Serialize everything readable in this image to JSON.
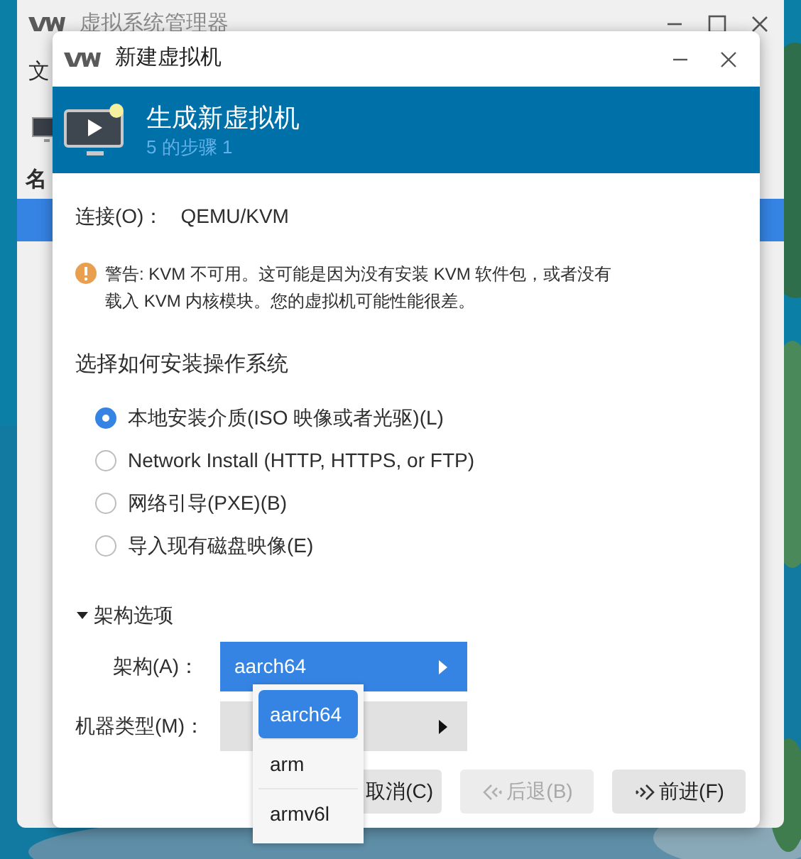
{
  "main_window": {
    "title": "虚拟系统管理器",
    "menu_fragment": "文",
    "column_header_fragment": "名"
  },
  "dialog": {
    "title": "新建虚拟机",
    "header": {
      "title": "生成新虚拟机",
      "subtitle": "5 的步骤 1"
    },
    "connection": {
      "label": "连接(O)：",
      "value": "QEMU/KVM"
    },
    "warning_lines": [
      "警告: KVM 不可用。这可能是因为没有安装 KVM 软件包，或者没有",
      "载入 KVM 内核模块。您的虚拟机可能性能很差。"
    ],
    "install_prompt": "选择如何安装操作系统",
    "install_options": [
      {
        "label": "本地安装介质(ISO 映像或者光驱)(L)",
        "selected": true
      },
      {
        "label": "Network Install (HTTP, HTTPS, or FTP)",
        "selected": false
      },
      {
        "label": "网络引导(PXE)(B)",
        "selected": false
      },
      {
        "label": "导入现有磁盘映像(E)",
        "selected": false
      }
    ],
    "arch_section": {
      "label": "架构选项",
      "expanded": true,
      "fields": [
        {
          "label": "架构(A)：",
          "value": "aarch64",
          "open": true
        },
        {
          "label": "机器类型(M)：",
          "open": false
        }
      ]
    },
    "dropdown": [
      {
        "label": "aarch64",
        "selected": true
      },
      {
        "label": "arm",
        "selected": false
      },
      {
        "label": "armv6l",
        "selected": false
      }
    ],
    "buttons": [
      {
        "label": "取消(C)",
        "kind": "cancel",
        "disabled": false
      },
      {
        "label": "后退(B)",
        "kind": "back",
        "disabled": true
      },
      {
        "label": "前进(F)",
        "kind": "forward",
        "disabled": false
      }
    ]
  }
}
